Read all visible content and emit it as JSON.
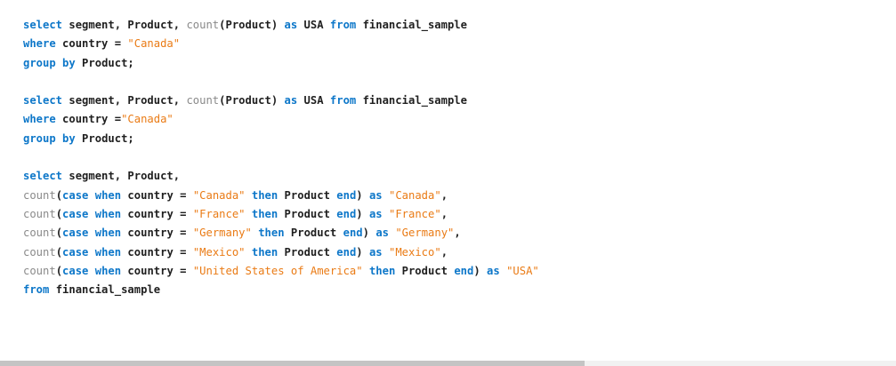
{
  "code": {
    "lines": [
      [
        {
          "t": "select",
          "c": "kw"
        },
        {
          "t": " segment, Product, ",
          "c": "id"
        },
        {
          "t": "count",
          "c": "fn"
        },
        {
          "t": "(Product) ",
          "c": "id"
        },
        {
          "t": "as",
          "c": "kw"
        },
        {
          "t": " USA ",
          "c": "id"
        },
        {
          "t": "from",
          "c": "kw"
        },
        {
          "t": " financial_sample",
          "c": "id"
        }
      ],
      [
        {
          "t": "where",
          "c": "kw"
        },
        {
          "t": " country = ",
          "c": "id"
        },
        {
          "t": "\"Canada\"",
          "c": "str"
        }
      ],
      [
        {
          "t": "group",
          "c": "kw"
        },
        {
          "t": " ",
          "c": "id"
        },
        {
          "t": "by",
          "c": "kw"
        },
        {
          "t": " Product;",
          "c": "id"
        }
      ],
      [],
      [
        {
          "t": "select",
          "c": "kw"
        },
        {
          "t": " segment, Product, ",
          "c": "id"
        },
        {
          "t": "count",
          "c": "fn"
        },
        {
          "t": "(Product) ",
          "c": "id"
        },
        {
          "t": "as",
          "c": "kw"
        },
        {
          "t": " USA ",
          "c": "id"
        },
        {
          "t": "from",
          "c": "kw"
        },
        {
          "t": " financial_sample",
          "c": "id"
        }
      ],
      [
        {
          "t": "where",
          "c": "kw"
        },
        {
          "t": " country =",
          "c": "id"
        },
        {
          "t": "\"Canada\"",
          "c": "str"
        }
      ],
      [
        {
          "t": "group",
          "c": "kw"
        },
        {
          "t": " ",
          "c": "id"
        },
        {
          "t": "by",
          "c": "kw"
        },
        {
          "t": " Product;",
          "c": "id"
        }
      ],
      [],
      [
        {
          "t": "select",
          "c": "kw"
        },
        {
          "t": " segment, Product,",
          "c": "id"
        }
      ],
      [
        {
          "t": "count",
          "c": "fn"
        },
        {
          "t": "(",
          "c": "id"
        },
        {
          "t": "case",
          "c": "kw"
        },
        {
          "t": " ",
          "c": "id"
        },
        {
          "t": "when",
          "c": "kw"
        },
        {
          "t": " country = ",
          "c": "id"
        },
        {
          "t": "\"Canada\"",
          "c": "str"
        },
        {
          "t": " ",
          "c": "id"
        },
        {
          "t": "then",
          "c": "kw"
        },
        {
          "t": " Product ",
          "c": "id"
        },
        {
          "t": "end",
          "c": "kw"
        },
        {
          "t": ") ",
          "c": "id"
        },
        {
          "t": "as",
          "c": "kw"
        },
        {
          "t": " ",
          "c": "id"
        },
        {
          "t": "\"Canada\"",
          "c": "str"
        },
        {
          "t": ",",
          "c": "id"
        }
      ],
      [
        {
          "t": "count",
          "c": "fn"
        },
        {
          "t": "(",
          "c": "id"
        },
        {
          "t": "case",
          "c": "kw"
        },
        {
          "t": " ",
          "c": "id"
        },
        {
          "t": "when",
          "c": "kw"
        },
        {
          "t": " country = ",
          "c": "id"
        },
        {
          "t": "\"France\"",
          "c": "str"
        },
        {
          "t": " ",
          "c": "id"
        },
        {
          "t": "then",
          "c": "kw"
        },
        {
          "t": " Product ",
          "c": "id"
        },
        {
          "t": "end",
          "c": "kw"
        },
        {
          "t": ") ",
          "c": "id"
        },
        {
          "t": "as",
          "c": "kw"
        },
        {
          "t": " ",
          "c": "id"
        },
        {
          "t": "\"France\"",
          "c": "str"
        },
        {
          "t": ",",
          "c": "id"
        }
      ],
      [
        {
          "t": "count",
          "c": "fn"
        },
        {
          "t": "(",
          "c": "id"
        },
        {
          "t": "case",
          "c": "kw"
        },
        {
          "t": " ",
          "c": "id"
        },
        {
          "t": "when",
          "c": "kw"
        },
        {
          "t": " country = ",
          "c": "id"
        },
        {
          "t": "\"Germany\"",
          "c": "str"
        },
        {
          "t": " ",
          "c": "id"
        },
        {
          "t": "then",
          "c": "kw"
        },
        {
          "t": " Product ",
          "c": "id"
        },
        {
          "t": "end",
          "c": "kw"
        },
        {
          "t": ") ",
          "c": "id"
        },
        {
          "t": "as",
          "c": "kw"
        },
        {
          "t": " ",
          "c": "id"
        },
        {
          "t": "\"Germany\"",
          "c": "str"
        },
        {
          "t": ",",
          "c": "id"
        }
      ],
      [
        {
          "t": "count",
          "c": "fn"
        },
        {
          "t": "(",
          "c": "id"
        },
        {
          "t": "case",
          "c": "kw"
        },
        {
          "t": " ",
          "c": "id"
        },
        {
          "t": "when",
          "c": "kw"
        },
        {
          "t": " country = ",
          "c": "id"
        },
        {
          "t": "\"Mexico\"",
          "c": "str"
        },
        {
          "t": " ",
          "c": "id"
        },
        {
          "t": "then",
          "c": "kw"
        },
        {
          "t": " Product ",
          "c": "id"
        },
        {
          "t": "end",
          "c": "kw"
        },
        {
          "t": ") ",
          "c": "id"
        },
        {
          "t": "as",
          "c": "kw"
        },
        {
          "t": " ",
          "c": "id"
        },
        {
          "t": "\"Mexico\"",
          "c": "str"
        },
        {
          "t": ",",
          "c": "id"
        }
      ],
      [
        {
          "t": "count",
          "c": "fn"
        },
        {
          "t": "(",
          "c": "id"
        },
        {
          "t": "case",
          "c": "kw"
        },
        {
          "t": " ",
          "c": "id"
        },
        {
          "t": "when",
          "c": "kw"
        },
        {
          "t": " country = ",
          "c": "id"
        },
        {
          "t": "\"United States of America\"",
          "c": "str"
        },
        {
          "t": " ",
          "c": "id"
        },
        {
          "t": "then",
          "c": "kw"
        },
        {
          "t": " Product ",
          "c": "id"
        },
        {
          "t": "end",
          "c": "kw"
        },
        {
          "t": ") ",
          "c": "id"
        },
        {
          "t": "as",
          "c": "kw"
        },
        {
          "t": " ",
          "c": "id"
        },
        {
          "t": "\"USA\"",
          "c": "str"
        }
      ],
      [
        {
          "t": "from",
          "c": "kw"
        },
        {
          "t": " financial_sample",
          "c": "id"
        }
      ]
    ]
  },
  "colors": {
    "keyword": "#0d77c9",
    "string": "#ea7b15",
    "function": "#8a8a8a",
    "identifier": "#1f1f1f",
    "scrollbar_track": "#f1f1f1",
    "scrollbar_thumb": "#c4c4c4"
  }
}
